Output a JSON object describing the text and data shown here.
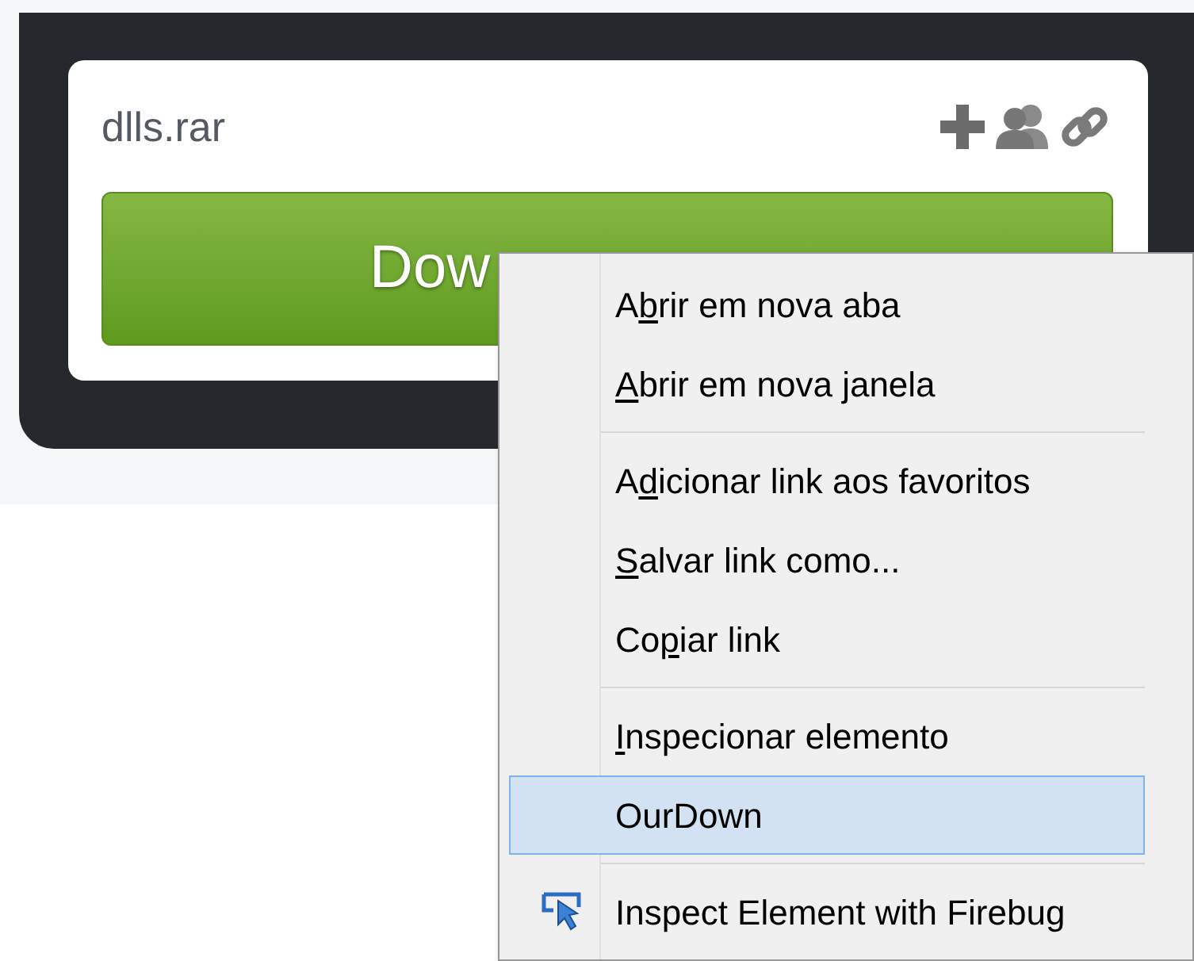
{
  "file_card": {
    "filename": "dlls.rar",
    "download_button": "Dow"
  },
  "context_menu": [
    {
      "kind": "item",
      "before": "A",
      "key": "b",
      "after": "rir em nova aba",
      "selected": false
    },
    {
      "kind": "item",
      "key": "A",
      "after": "brir em nova janela",
      "selected": false
    },
    {
      "kind": "separator"
    },
    {
      "kind": "item",
      "before": "A",
      "key": "d",
      "after": "icionar link aos favoritos",
      "selected": false
    },
    {
      "kind": "item",
      "key": "S",
      "after": "alvar link como...",
      "selected": false
    },
    {
      "kind": "item",
      "before": "Co",
      "key": "p",
      "after": "iar link",
      "selected": false
    },
    {
      "kind": "separator"
    },
    {
      "kind": "item",
      "key": "I",
      "after": "nspecionar elemento",
      "selected": false
    },
    {
      "kind": "item",
      "before": "OurDown",
      "selected": true
    },
    {
      "kind": "separator"
    },
    {
      "kind": "icon_item",
      "before": "Inspect Element with Firebug",
      "selected": false
    }
  ]
}
